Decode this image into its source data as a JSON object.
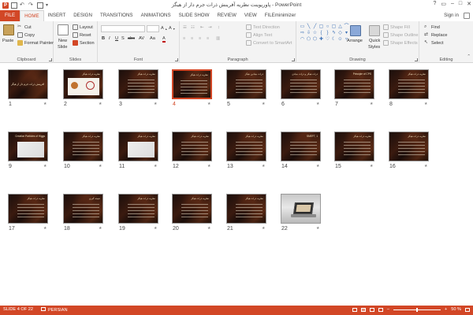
{
  "window": {
    "title": "پاورپوینت نظریه آفرینش ذرات جرم دار از هیگز - PowerPoint",
    "controls": [
      "?",
      "▭",
      "–",
      "□",
      "✕"
    ]
  },
  "tabs": [
    "FILE",
    "HOME",
    "INSERT",
    "DESIGN",
    "TRANSITIONS",
    "ANIMATIONS",
    "SLIDE SHOW",
    "REVIEW",
    "VIEW",
    "FILEminimizer"
  ],
  "active_tab": "HOME",
  "signin": "Sign in",
  "ribbon": {
    "clipboard": {
      "label": "Clipboard",
      "paste": "Paste",
      "cut": "Cut",
      "copy": "Copy",
      "format_painter": "Format Painter"
    },
    "slides": {
      "label": "Slides",
      "new_slide": "New",
      "new_slide2": "Slide",
      "layout": "Layout",
      "reset": "Reset",
      "section": "Section"
    },
    "font": {
      "label": "Font",
      "bold": "B",
      "italic": "I",
      "underline": "U",
      "strike": "S",
      "abc": "abc",
      "av": "AV",
      "aa": "Aa"
    },
    "paragraph": {
      "label": "Paragraph",
      "text_direction": "Text Direction",
      "align_text": "Align Text",
      "convert_smartart": "Convert to SmartArt"
    },
    "drawing": {
      "label": "Drawing",
      "arrange": "Arrange",
      "quick_styles": "Quick",
      "quick_styles2": "Styles",
      "shape_fill": "Shape Fill",
      "shape_outline": "Shape Outline",
      "shape_effects": "Shape Effects"
    },
    "editing": {
      "label": "Editing",
      "find": "Find",
      "replace": "Replace",
      "select": "Select"
    }
  },
  "slides": [
    {
      "num": "1",
      "title": "نظریه آفرینش ذرات جرم دار از هیگز",
      "kind": "title"
    },
    {
      "num": "2",
      "title": "نظریه ذرات هیگز",
      "kind": "panel"
    },
    {
      "num": "3",
      "title": "نظریه ذرات هیگز",
      "kind": "dark"
    },
    {
      "num": "4",
      "title": "نظریه ذرات هیگز",
      "kind": "dark",
      "selected": true
    },
    {
      "num": "5",
      "title": "ذرات بنیادین هیگز",
      "kind": "dark"
    },
    {
      "num": "6",
      "title": "ذرات هیگز و ذرات بنیادی",
      "kind": "dark"
    },
    {
      "num": "7",
      "title": "Principle of CPS",
      "kind": "dark"
    },
    {
      "num": "8",
      "title": "نظریه ذرات هیگز",
      "kind": "dark"
    },
    {
      "num": "9",
      "title": "Creation Particles of Higgs",
      "kind": "chart"
    },
    {
      "num": "10",
      "title": "نظریه ذرات هیگز",
      "kind": "dark"
    },
    {
      "num": "11",
      "title": "نظریه ذرات هیگز",
      "kind": "chart"
    },
    {
      "num": "12",
      "title": "نظریه ذرات هیگز",
      "kind": "dark"
    },
    {
      "num": "13",
      "title": "نظریه ذرات هیگز",
      "kind": "dark"
    },
    {
      "num": "14",
      "title": "SMEFT, 1",
      "kind": "dark"
    },
    {
      "num": "15",
      "title": "نظریه ذرات هیگز",
      "kind": "dark"
    },
    {
      "num": "16",
      "title": "نظریه ذرات هیگز",
      "kind": "dark"
    },
    {
      "num": "17",
      "title": "نظریه ذرات هیگز",
      "kind": "dark"
    },
    {
      "num": "18",
      "title": "نتیجه گیری",
      "kind": "dark"
    },
    {
      "num": "19",
      "title": "نظریه ذرات هیگز",
      "kind": "dark"
    },
    {
      "num": "20",
      "title": "نظریه ذرات هیگز",
      "kind": "dark"
    },
    {
      "num": "21",
      "title": "نظریه ذرات هیگز",
      "kind": "dark"
    },
    {
      "num": "22",
      "title": "",
      "kind": "photo"
    }
  ],
  "status": {
    "slide_info": "SLIDE 4 OF 22",
    "language": "PERSIAN",
    "zoom": "50 %",
    "zoom_level": 0.5
  },
  "colors": {
    "accent": "#d24726",
    "ribbon_bg": "#f3f3f3"
  }
}
